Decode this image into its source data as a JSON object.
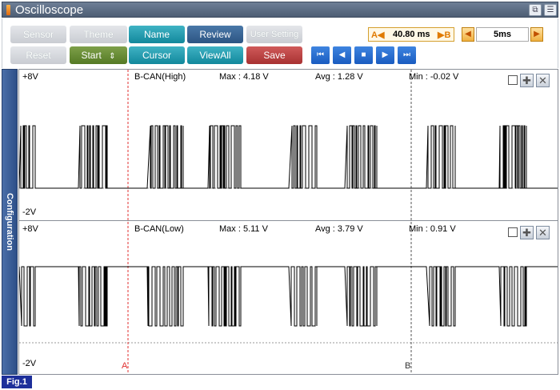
{
  "window": {
    "title": "Oscilloscope"
  },
  "toolbar": {
    "row1": [
      "Sensor",
      "Theme",
      "Name",
      "Review",
      "User Setting"
    ],
    "row2": [
      "Reset",
      "Start",
      "Cursor",
      "ViewAll",
      "Save"
    ],
    "start_arrows": "⇕",
    "cursor_a": "A◀",
    "cursor_value": "40.80 ms",
    "cursor_b": "▶B",
    "timescale": "5ms",
    "playback": [
      "first",
      "prev",
      "stop",
      "next",
      "last"
    ]
  },
  "sidebar": {
    "label": "Configuration"
  },
  "channels": [
    {
      "top_label": "+8V",
      "bottom_label": "-2V",
      "name": "B-CAN(High)",
      "max": "Max : 4.18 V",
      "avg": "Avg : 1.28 V",
      "min": "Min : -0.02 V"
    },
    {
      "top_label": "+8V",
      "bottom_label": "-2V",
      "name": "B-CAN(Low)",
      "max": "Max : 5.11 V",
      "avg": "Avg : 3.79 V",
      "min": "Min : 0.91 V"
    }
  ],
  "markers": {
    "a": "A",
    "b": "B"
  },
  "figure_label": "Fig.1",
  "colors": {
    "cursor_a": "#e03030",
    "cursor_b": "#555555",
    "title_bar": "#5d6e86",
    "side_tab": "#3a5d98",
    "fig_badge": "#1d2f9a"
  }
}
